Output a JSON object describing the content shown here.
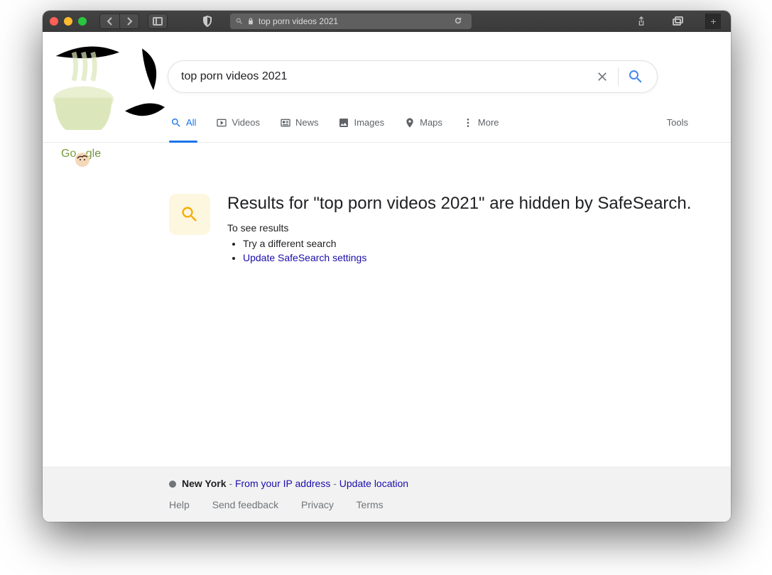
{
  "browser": {
    "address_text": "top porn videos 2021"
  },
  "search": {
    "query": "top porn videos 2021"
  },
  "tabs": {
    "all": "All",
    "videos": "Videos",
    "news": "News",
    "images": "Images",
    "maps": "Maps",
    "more": "More",
    "tools": "Tools"
  },
  "notice": {
    "heading": "Results for \"top porn videos 2021\" are hidden by SafeSearch.",
    "subtitle": "To see results",
    "bullet1": "Try a different search",
    "bullet2": "Update SafeSearch settings"
  },
  "footer": {
    "city": "New York",
    "sep1": " - ",
    "ip_link": "From your IP address",
    "sep2": " - ",
    "update_link": "Update location",
    "help": "Help",
    "feedback": "Send feedback",
    "privacy": "Privacy",
    "terms": "Terms"
  }
}
